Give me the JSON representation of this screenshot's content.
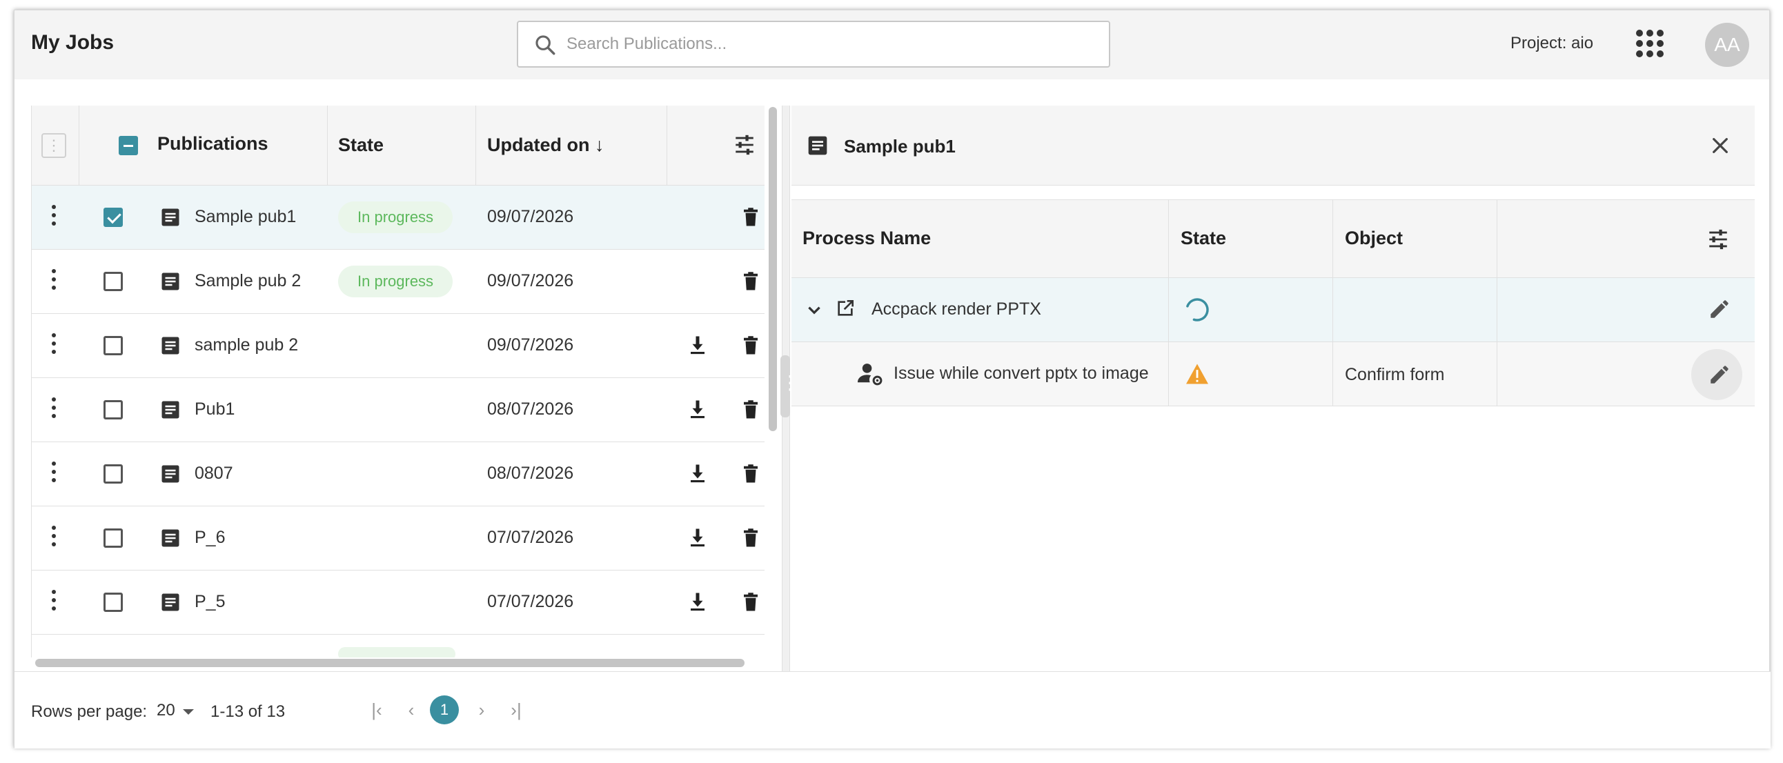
{
  "header": {
    "title": "My Jobs",
    "search_placeholder": "Search Publications...",
    "project_label": "Project: aio",
    "apps_icon": "apps-grid-icon",
    "avatar_initials": "AA"
  },
  "left_table": {
    "columns": {
      "publications": "Publications",
      "state": "State",
      "updated_on": "Updated on ↓"
    },
    "rows": [
      {
        "name": "Sample pub1",
        "state": "In progress",
        "updated_on": "09/07/2026",
        "checked": true,
        "download": false
      },
      {
        "name": "Sample pub 2",
        "state": "In progress",
        "updated_on": "09/07/2026",
        "checked": false,
        "download": false
      },
      {
        "name": "sample pub 2",
        "state": "",
        "updated_on": "09/07/2026",
        "checked": false,
        "download": true
      },
      {
        "name": "Pub1",
        "state": "",
        "updated_on": "08/07/2026",
        "checked": false,
        "download": true
      },
      {
        "name": "0807",
        "state": "",
        "updated_on": "08/07/2026",
        "checked": false,
        "download": true
      },
      {
        "name": "P_6",
        "state": "",
        "updated_on": "07/07/2026",
        "checked": false,
        "download": true
      },
      {
        "name": "P_5",
        "state": "",
        "updated_on": "07/07/2026",
        "checked": false,
        "download": true
      }
    ]
  },
  "right_panel": {
    "title": "Sample pub1",
    "columns": {
      "process_name": "Process Name",
      "state": "State",
      "object": "Object"
    },
    "rows": [
      {
        "process": "Accpack render PPTX",
        "state_icon": "loading-spinner-icon",
        "object": ""
      },
      {
        "process": "Issue while convert pptx to image",
        "state_icon": "warning-icon",
        "object": "Confirm form"
      }
    ]
  },
  "footer": {
    "rows_per_page_label": "Rows per page:",
    "rows_per_page_value": "20",
    "range": "1-13 of 13",
    "current_page": "1"
  },
  "colors": {
    "accent": "#3a8fa0",
    "in_progress_text": "#5cb85c",
    "in_progress_bg": "#eaf6ea",
    "warning": "#f0a030"
  }
}
